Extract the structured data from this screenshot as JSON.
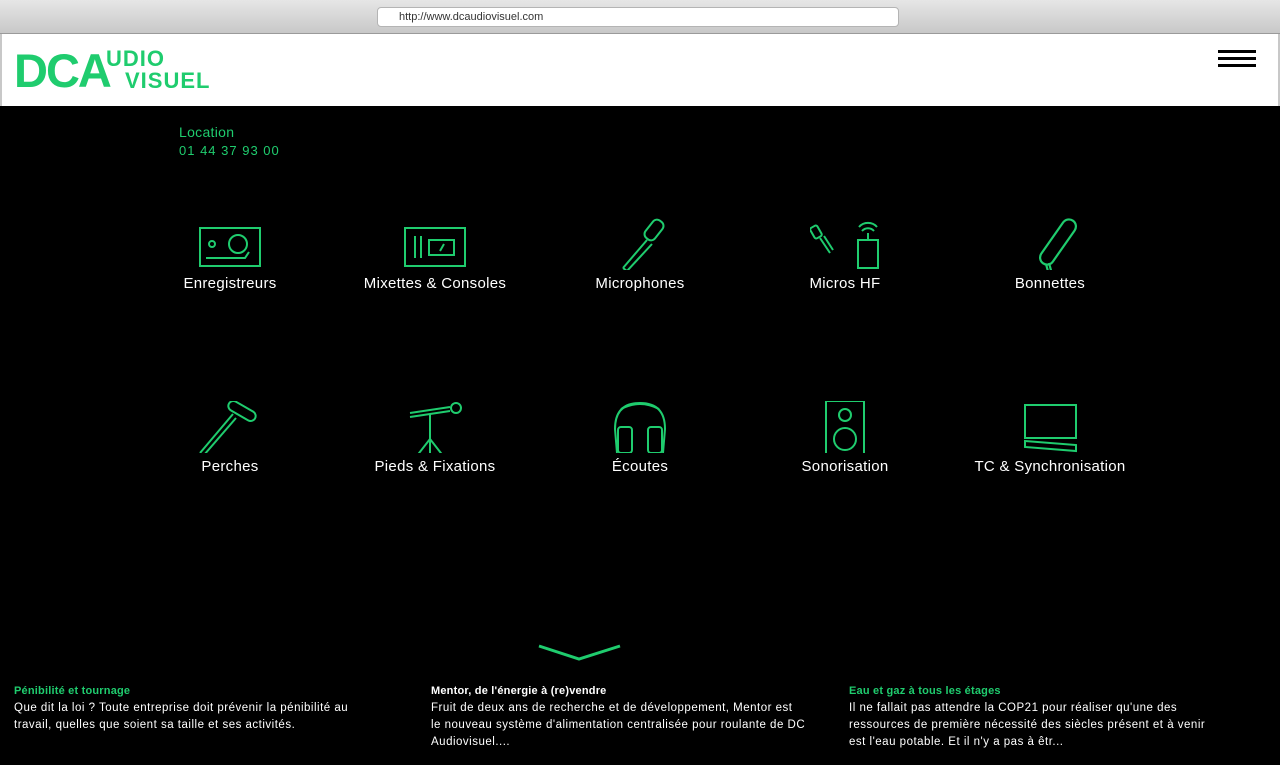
{
  "browser": {
    "url": "http://www.dcaudiovisuel.com"
  },
  "logo": {
    "dca": "DCA",
    "audio": "UDIO",
    "visuel": "VISUEL"
  },
  "header": {
    "menu_icon": "hamburger-menu-icon"
  },
  "contact": {
    "label": "Location",
    "phone": "01 44 37 93 00"
  },
  "categories": [
    {
      "label": "Enregistreurs",
      "icon": "recorder-icon"
    },
    {
      "label": "Mixettes & Consoles",
      "icon": "mixer-icon"
    },
    {
      "label": "Microphones",
      "icon": "microphone-icon"
    },
    {
      "label": "Micros HF",
      "icon": "wireless-mic-icon"
    },
    {
      "label": "Bonnettes",
      "icon": "windscreen-icon"
    },
    {
      "label": "Perches",
      "icon": "boom-pole-icon"
    },
    {
      "label": "Pieds & Fixations",
      "icon": "mic-stand-icon"
    },
    {
      "label": "Écoutes",
      "icon": "headphones-icon"
    },
    {
      "label": "Sonorisation",
      "icon": "speaker-icon"
    },
    {
      "label": "TC & Synchronisation",
      "icon": "timecode-clapper-icon"
    }
  ],
  "news": [
    {
      "title": "Pénibilité et tournage",
      "text": "Que dit la loi ? Toute entreprise doit prévenir la pénibilité au travail, quelles que soient sa taille et ses activités.",
      "title_color": "#1fcc6e"
    },
    {
      "title": "Mentor, de l'énergie à (re)vendre",
      "text": "Fruit de deux ans de recherche et de développement, Mentor est le nouveau système d'alimentation centralisée pour roulante de DC Audiovisuel....",
      "title_color": "#ffffff"
    },
    {
      "title": "Eau et gaz à tous les étages",
      "text": "Il ne fallait pas attendre la COP21 pour réaliser qu'une des ressources de première nécessité des siècles présent et à venir est l'eau potable. Et il n'y a pas à êtr...",
      "title_color": "#1fcc6e"
    }
  ],
  "colors": {
    "accent": "#1fcc6e",
    "background": "#000000",
    "header": "#ffffff"
  }
}
